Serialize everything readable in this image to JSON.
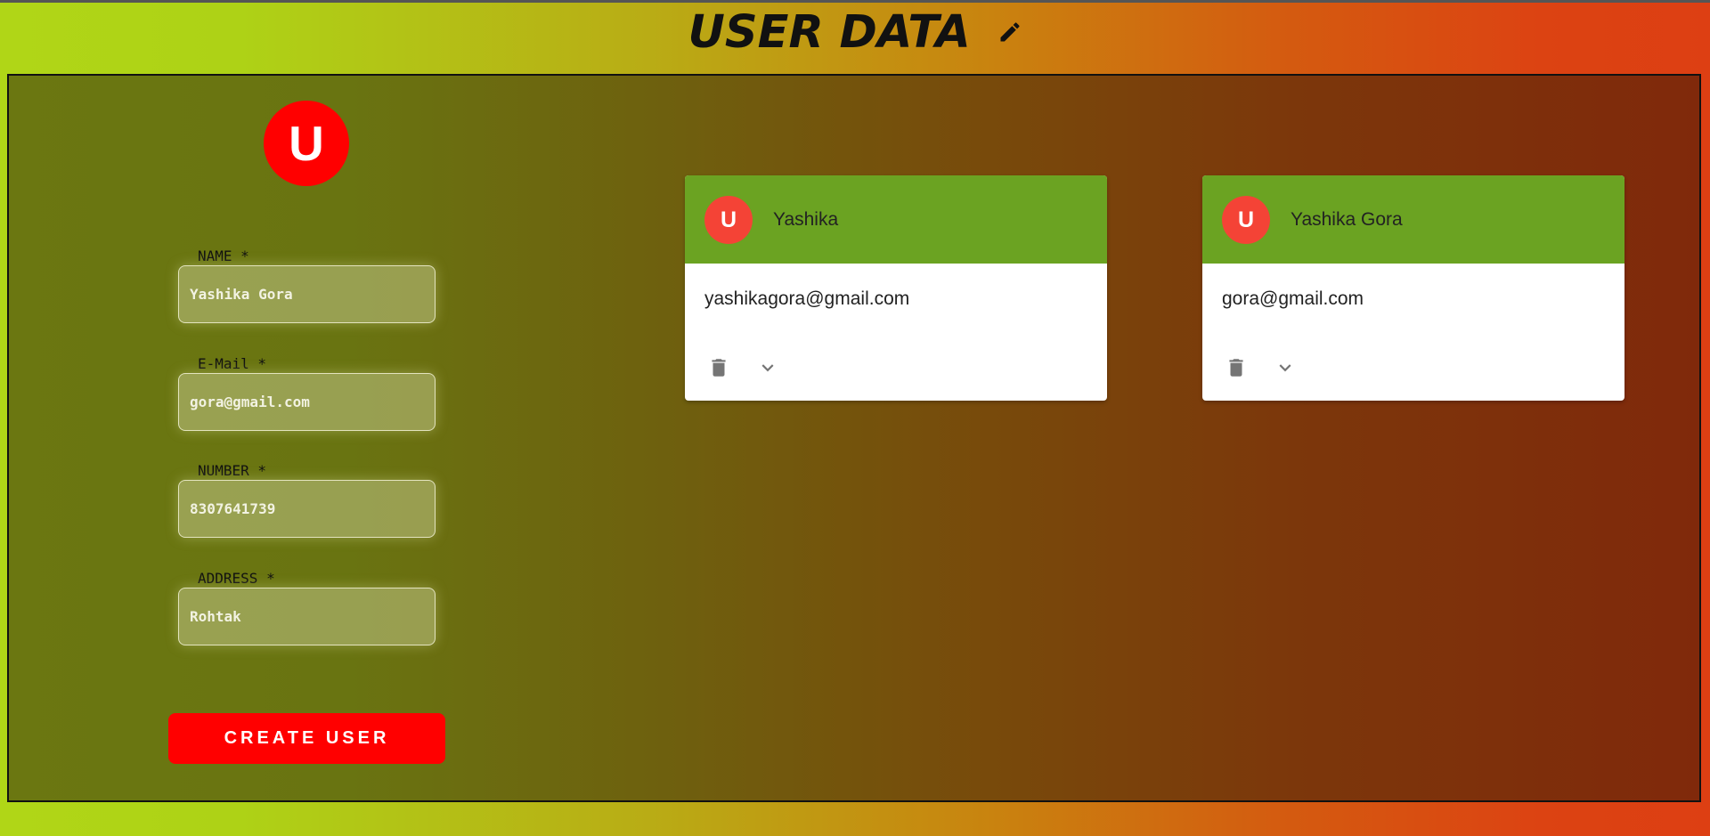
{
  "header": {
    "title": "USER DATA",
    "title_icon": "pencil-icon"
  },
  "form": {
    "avatar_letter": "U",
    "fields": [
      {
        "label": "NAME *",
        "value": "Yashika Gora"
      },
      {
        "label": "E-Mail *",
        "value": "gora@gmail.com"
      },
      {
        "label": "NUMBER *",
        "value": "8307641739"
      },
      {
        "label": "ADDRESS *",
        "value": "Rohtak"
      }
    ],
    "create_label": "CREATE USER",
    "accent_color": "#ff0000"
  },
  "users": [
    {
      "avatar_letter": "U",
      "name": "Yashika",
      "email": "yashikagora@gmail.com",
      "delete_icon": "trash-icon",
      "expand_icon": "chevron-down-icon"
    },
    {
      "avatar_letter": "U",
      "name": "Yashika Gora",
      "email": "gora@gmail.com",
      "delete_icon": "trash-icon",
      "expand_icon": "chevron-down-icon"
    }
  ],
  "colors": {
    "card_header": "#6ba322",
    "card_avatar": "#f44336",
    "icon_gray": "#757575"
  }
}
